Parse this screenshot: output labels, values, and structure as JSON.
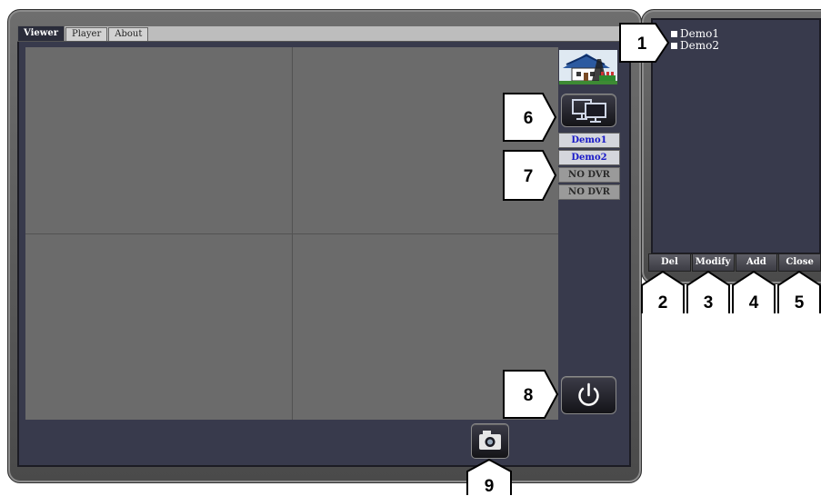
{
  "tabs": [
    {
      "label": "Viewer",
      "active": true
    },
    {
      "label": "Player",
      "active": false
    },
    {
      "label": "About",
      "active": false
    }
  ],
  "dvr_list": [
    {
      "label": "Demo1",
      "state": "connected"
    },
    {
      "label": "Demo2",
      "state": "connected"
    },
    {
      "label": "NO DVR",
      "state": "empty"
    },
    {
      "label": "NO DVR",
      "state": "empty"
    }
  ],
  "site_list": {
    "items": [
      {
        "label": "Demo1",
        "checked": false
      },
      {
        "label": "Demo2",
        "checked": false
      }
    ]
  },
  "sidebar_buttons": {
    "del": "Del",
    "modify": "Modify",
    "add": "Add",
    "close": "Close"
  },
  "callouts": {
    "c1": "1",
    "c2": "2",
    "c3": "3",
    "c4": "4",
    "c5": "5",
    "c6": "6",
    "c7": "7",
    "c8": "8",
    "c9": "9"
  },
  "icons": {
    "multi_screen": "multi-monitor-icon",
    "power": "power-icon",
    "snapshot": "camera-icon"
  },
  "colors": {
    "dvr_connected_text": "#1818c8",
    "panel_background": "#383a4c",
    "video_cell": "#6b6b6b"
  }
}
